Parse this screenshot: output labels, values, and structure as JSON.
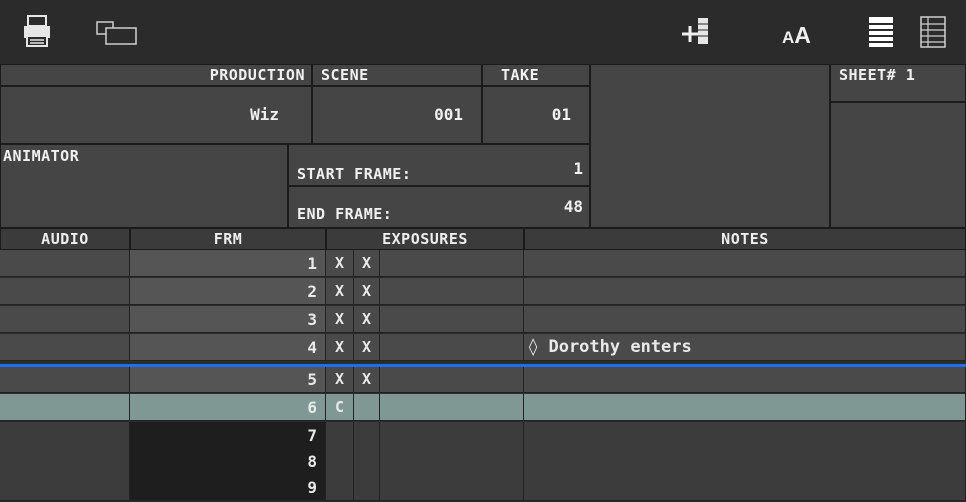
{
  "toolbar": {
    "left_icons": [
      "print-icon",
      "window-icon"
    ],
    "right_icons": [
      "add-column-icon",
      "font-size-icon",
      "list-view-icon",
      "grid-view-icon"
    ],
    "font_size_label": "AA"
  },
  "header": {
    "production_label": "PRODUCTION",
    "production_value": "Wiz",
    "scene_label": "SCENE",
    "scene_value": "001",
    "take_label": "TAKE",
    "take_value": "01",
    "sheet_label": "SHEET# 1",
    "animator_label": "ANIMATOR",
    "start_frame_label": "START FRAME:",
    "start_frame_value": "1",
    "end_frame_label": "END FRAME:",
    "end_frame_value": "48"
  },
  "columns": {
    "audio": "AUDIO",
    "frm": "FRM",
    "exposures": "EXPOSURES",
    "notes": "NOTES"
  },
  "rows": [
    {
      "frm": "1",
      "exp1": "X",
      "exp2": "X",
      "note": ""
    },
    {
      "frm": "2",
      "exp1": "X",
      "exp2": "X",
      "note": ""
    },
    {
      "frm": "3",
      "exp1": "X",
      "exp2": "X",
      "note": ""
    },
    {
      "frm": "4",
      "exp1": "X",
      "exp2": "X",
      "note": "◊ Dorothy enters"
    },
    {
      "frm": "5",
      "exp1": "X",
      "exp2": "X",
      "note": ""
    },
    {
      "frm": "6",
      "exp1": "C",
      "exp2": "",
      "note": ""
    },
    {
      "frm": "7",
      "exp1": "",
      "exp2": "",
      "note": ""
    },
    {
      "frm": "8",
      "exp1": "",
      "exp2": "",
      "note": ""
    },
    {
      "frm": "9",
      "exp1": "",
      "exp2": "",
      "note": ""
    }
  ],
  "colors": {
    "marker_line": "#1e6fe8",
    "selected_row": "#7f9893",
    "background": "#2c2c2c"
  }
}
